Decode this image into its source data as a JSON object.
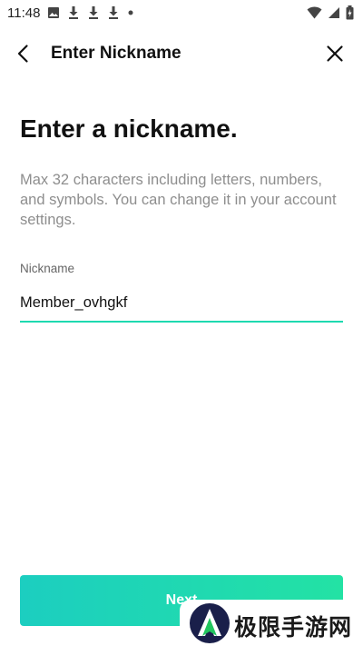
{
  "status_bar": {
    "time": "11:48",
    "left_icons": [
      "image-icon",
      "download-icon",
      "download-icon",
      "download-icon",
      "dot-icon"
    ],
    "right_icons": [
      "wifi-icon",
      "signal-icon",
      "battery-icon"
    ]
  },
  "app_bar": {
    "title": "Enter Nickname",
    "back_icon": "chevron-left-icon",
    "close_icon": "close-icon"
  },
  "content": {
    "heading": "Enter a nickname.",
    "description": "Max 32 characters including letters, numbers, and symbols. You can change it in your account settings.",
    "nickname_label": "Nickname",
    "nickname_value": "Member_ovhgkf"
  },
  "next_button": {
    "label": "Next"
  },
  "watermark": {
    "text": "极限手游网"
  },
  "colors": {
    "accent": "#1ed9b0",
    "button_gradient_start": "#1ccec0",
    "button_gradient_end": "#23e2a4",
    "description_text": "#8e8e8e"
  }
}
